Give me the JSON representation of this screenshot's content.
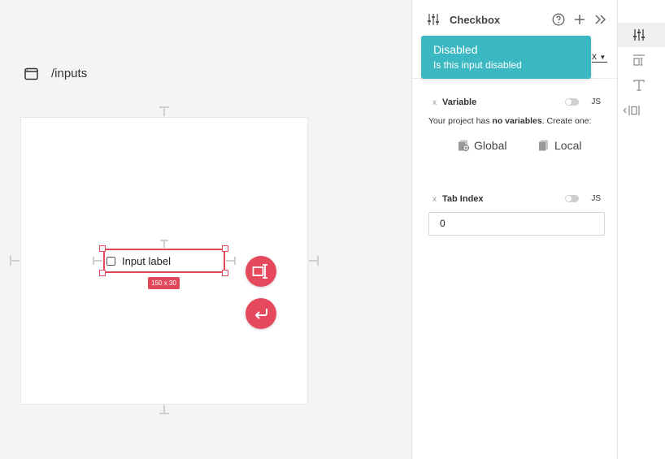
{
  "canvas": {
    "page_path": "/inputs",
    "selected_element": {
      "label": "Input label",
      "dimensions": "150 x 30"
    }
  },
  "panel": {
    "title": "Checkbox",
    "peek_value": "x",
    "tooltip": {
      "title": "Disabled",
      "description": "Is this input disabled"
    },
    "variable": {
      "remove_label": "x",
      "name": "Variable",
      "js_label": "JS",
      "no_vars_prefix": "Your project has ",
      "no_vars_bold": "no variables",
      "no_vars_suffix": ". Create one:",
      "global_label": "Global",
      "local_label": "Local"
    },
    "tab_index": {
      "remove_label": "x",
      "name": "Tab Index",
      "js_label": "JS",
      "value": "0"
    }
  },
  "colors": {
    "accent": "#e6495e",
    "tooltip": "#3bb8c1"
  },
  "icons": {
    "page": "browser-window-icon",
    "panel": "sliders-icon",
    "help": "question-circle-icon",
    "add": "plus-icon",
    "collapse": "double-chevron-right-icon",
    "global": "global-variable-icon",
    "local": "local-variable-icon",
    "fab_1": "text-cursor-icon",
    "fab_2": "enter-return-icon",
    "rail": [
      "sliders-icon",
      "align-layout-icon",
      "text-type-icon",
      "spacing-icon"
    ]
  }
}
